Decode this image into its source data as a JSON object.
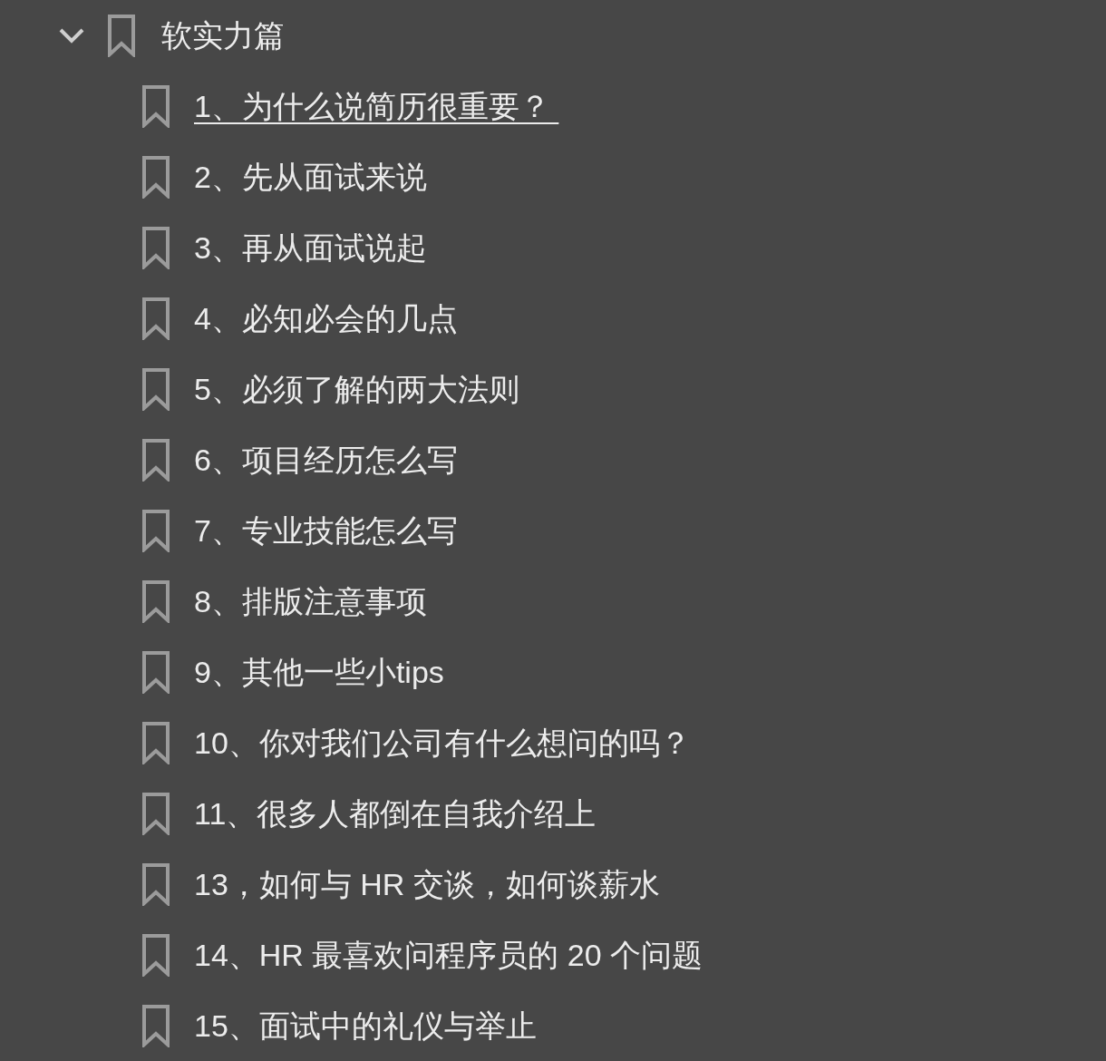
{
  "bookmarks": [
    {
      "title": "软实力篇",
      "expanded": true,
      "selected": false,
      "children": [
        {
          "title": "1、为什么说简历很重要？ ",
          "selected": true
        },
        {
          "title": "2、先从面试来说",
          "selected": false
        },
        {
          "title": "3、再从面试说起",
          "selected": false
        },
        {
          "title": "4、必知必会的几点",
          "selected": false
        },
        {
          "title": "5、必须了解的两大法则",
          "selected": false
        },
        {
          "title": "6、项目经历怎么写",
          "selected": false
        },
        {
          "title": "7、专业技能怎么写",
          "selected": false
        },
        {
          "title": "8、排版注意事项",
          "selected": false
        },
        {
          "title": "9、其他一些小tips",
          "selected": false
        },
        {
          "title": "10、你对我们公司有什么想问的吗？",
          "selected": false
        },
        {
          "title": "11、很多人都倒在自我介绍上",
          "selected": false
        },
        {
          "title": "13，如何与 HR 交谈，如何谈薪水",
          "selected": false
        },
        {
          "title": "14、HR 最喜欢问程序员的 20 个问题",
          "selected": false
        },
        {
          "title": "15、面试中的礼仪与举止",
          "selected": false
        }
      ]
    }
  ]
}
